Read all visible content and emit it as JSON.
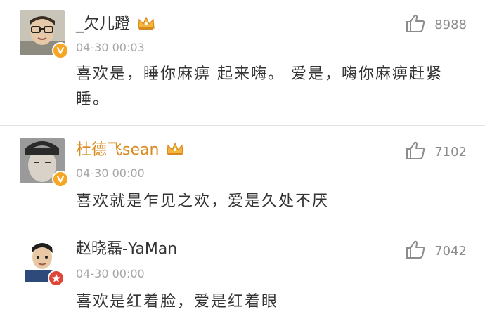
{
  "comments": [
    {
      "username": "_欠儿蹬",
      "timestamp": "04-30 00:03",
      "text": "喜欢是，睡你麻痹 起来嗨。 爱是，嗨你麻痹赶紧睡。",
      "likes": "8988",
      "badge": "gold"
    },
    {
      "username": "杜德飞sean",
      "timestamp": "04-30 00:00",
      "text": "喜欢就是乍见之欢，爱是久处不厌",
      "likes": "7102",
      "badge": "gold"
    },
    {
      "username": "赵晓磊-YaMan",
      "timestamp": "04-30 00:00",
      "text": "喜欢是红着脸，爱是红着眼",
      "likes": "7042",
      "badge": "red"
    }
  ],
  "colors": {
    "gold_name": "#d88a20",
    "dark_name": "#333333",
    "timestamp": "#a6a6a6",
    "like_icon": "#8c8c8c",
    "badge_gold": "#f5a623",
    "badge_red": "#e0453a"
  },
  "icons": {
    "like": "thumbs-up-icon",
    "crown": "crown-icon",
    "verified": "verified-badge-icon"
  }
}
